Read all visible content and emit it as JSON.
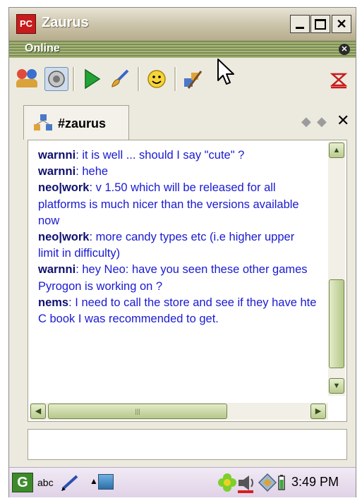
{
  "window": {
    "title": "Zaurus",
    "app_icon_text": "PC"
  },
  "status": {
    "label": "Online"
  },
  "toolbar": {
    "icons": [
      "users-icon",
      "speaker-icon",
      "play-icon",
      "brush-icon",
      "smiley-icon",
      "network-icon",
      "disconnect-icon"
    ]
  },
  "tab": {
    "label": "#zaurus"
  },
  "chat": {
    "messages": [
      {
        "nick": "warnni",
        "text": ": it is well ... should I say \"cute\" ?"
      },
      {
        "nick": "warnni",
        "text": ": hehe"
      },
      {
        "nick": "neo|work",
        "text": ": v 1.50 which will be released for all platforms is much nicer than the versions available now"
      },
      {
        "nick": "neo|work",
        "text": ": more candy types etc (i.e higher upper limit in difficulty)"
      },
      {
        "nick": "warnni",
        "text": ": hey Neo: have you seen these other games Pyrogon is working on ?"
      },
      {
        "nick": "nems",
        "text": ": I need to call the store and see if they have hte C book I was recommended to get."
      }
    ]
  },
  "input": {
    "value": "",
    "placeholder": ""
  },
  "taskbar": {
    "g_label": "G",
    "input_method": "abc",
    "time": "3:49 PM"
  },
  "colors": {
    "nick": "#10106e",
    "message": "#1a1ad1",
    "accent": "#7c8e51"
  }
}
